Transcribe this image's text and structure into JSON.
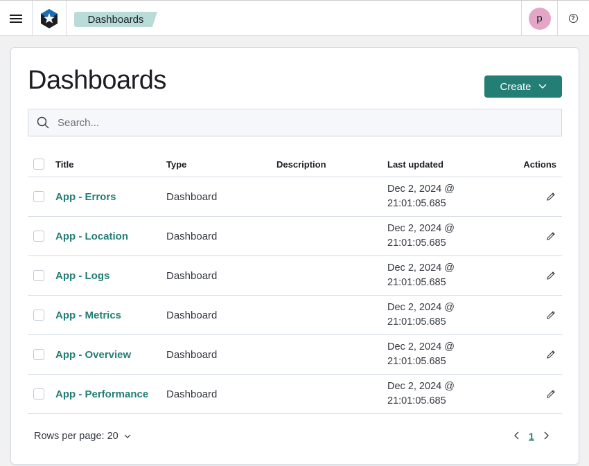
{
  "header": {
    "breadcrumb": "Dashboards",
    "avatar_initial": "p"
  },
  "main": {
    "title": "Dashboards",
    "create_label": "Create",
    "search_placeholder": "Search..."
  },
  "table": {
    "columns": {
      "title": "Title",
      "type": "Type",
      "description": "Description",
      "last_updated": "Last updated",
      "actions": "Actions"
    },
    "rows": [
      {
        "title": "App - Errors",
        "type": "Dashboard",
        "description": "",
        "updated_date": "Dec 2, 2024 @",
        "updated_time": "21:01:05.685"
      },
      {
        "title": "App - Location",
        "type": "Dashboard",
        "description": "",
        "updated_date": "Dec 2, 2024 @",
        "updated_time": "21:01:05.685"
      },
      {
        "title": "App - Logs",
        "type": "Dashboard",
        "description": "",
        "updated_date": "Dec 2, 2024 @",
        "updated_time": "21:01:05.685"
      },
      {
        "title": "App - Metrics",
        "type": "Dashboard",
        "description": "",
        "updated_date": "Dec 2, 2024 @",
        "updated_time": "21:01:05.685"
      },
      {
        "title": "App - Overview",
        "type": "Dashboard",
        "description": "",
        "updated_date": "Dec 2, 2024 @",
        "updated_time": "21:01:05.685"
      },
      {
        "title": "App - Performance",
        "type": "Dashboard",
        "description": "",
        "updated_date": "Dec 2, 2024 @",
        "updated_time": "21:01:05.685"
      }
    ]
  },
  "footer": {
    "rows_per_page": "Rows per page: 20",
    "current_page": "1"
  },
  "icons": {
    "menu": "hamburger-icon",
    "logo": "star-hexagon-logo",
    "help": "help-icon",
    "search": "search-icon",
    "chevron": "chevron-down-icon",
    "edit": "pencil-icon",
    "prev": "chevron-left-icon",
    "next": "chevron-right-icon"
  },
  "colors": {
    "accent": "#237e75",
    "breadcrumb_bg": "#b9dcd9",
    "avatar_bg": "#e4a6c7"
  }
}
